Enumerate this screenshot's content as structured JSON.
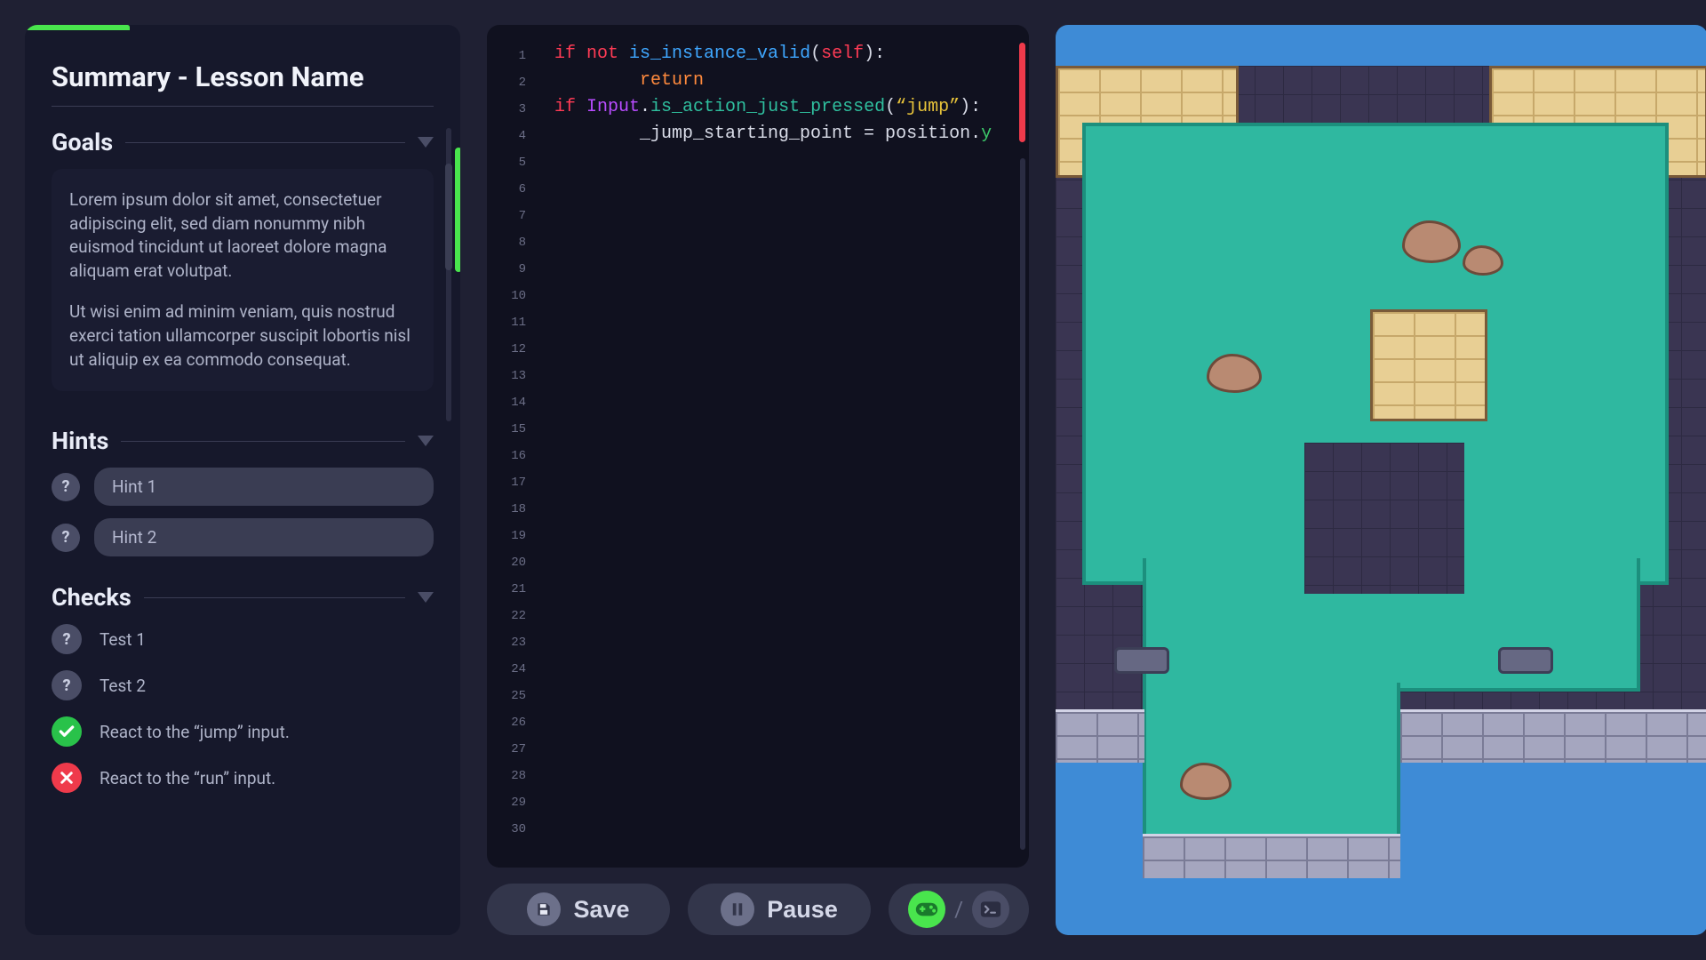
{
  "sidebar": {
    "title": "Summary - Lesson Name",
    "sections": {
      "goals": {
        "heading": "Goals",
        "p1": "Lorem ipsum dolor sit amet, consectetuer adipiscing elit, sed diam nonummy nibh euismod tincidunt ut laoreet dolore magna aliquam erat volutpat.",
        "p2": "Ut wisi enim ad minim veniam, quis nostrud exerci tation ullamcorper suscipit lobortis nisl ut aliquip ex ea commodo consequat."
      },
      "hints": {
        "heading": "Hints",
        "items": [
          "Hint 1",
          "Hint 2"
        ]
      },
      "checks": {
        "heading": "Checks",
        "items": [
          {
            "status": "unknown",
            "label": "Test 1"
          },
          {
            "status": "unknown",
            "label": "Test 2"
          },
          {
            "status": "pass",
            "label": "React to the “jump” input."
          },
          {
            "status": "fail",
            "label": "React to the “run” input."
          }
        ]
      }
    }
  },
  "editor": {
    "line_count": 30,
    "code_lines": [
      [
        {
          "cls": "tk-kw",
          "t": "if "
        },
        {
          "cls": "tk-kw",
          "t": "not "
        },
        {
          "cls": "tk-fn",
          "t": "is_instance_valid"
        },
        {
          "cls": "tk-txt",
          "t": "("
        },
        {
          "cls": "tk-self",
          "t": "self"
        },
        {
          "cls": "tk-txt",
          "t": "):"
        }
      ],
      [
        {
          "cls": "tk-txt",
          "t": "        "
        },
        {
          "cls": "tk-ret",
          "t": "return"
        }
      ],
      [
        {
          "cls": "tk-kw",
          "t": "if "
        },
        {
          "cls": "tk-type",
          "t": "Input"
        },
        {
          "cls": "tk-txt",
          "t": "."
        },
        {
          "cls": "tk-call",
          "t": "is_action_just_pressed"
        },
        {
          "cls": "tk-txt",
          "t": "("
        },
        {
          "cls": "tk-str",
          "t": "“jump”"
        },
        {
          "cls": "tk-txt",
          "t": "):"
        }
      ],
      [
        {
          "cls": "tk-txt",
          "t": "        _jump_starting_point = position."
        },
        {
          "cls": "tk-prop",
          "t": "y"
        }
      ]
    ]
  },
  "actions": {
    "save": "Save",
    "pause": "Pause"
  },
  "colors": {
    "accent_green": "#49e54d",
    "danger_red": "#ef3a4b"
  }
}
